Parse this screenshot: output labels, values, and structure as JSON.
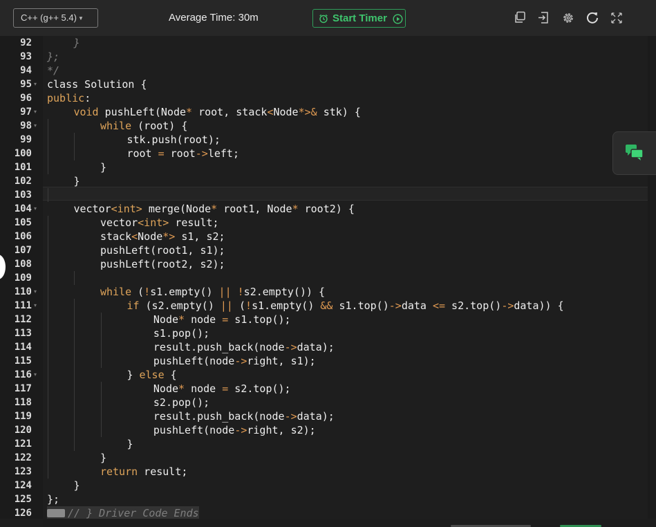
{
  "toolbar": {
    "language": "C++ (g++ 5.4)",
    "average_time": "Average Time: 30m",
    "timer_button": "Start Timer"
  },
  "colors": {
    "accent_green": "#3ec46d",
    "keyword": "#dfa45a",
    "comment": "#7e7e7e",
    "background": "#1e1e1e"
  },
  "icons": [
    "copy-icon",
    "sign-in-icon",
    "settings-gear-icon",
    "reset-icon",
    "fullscreen-icon",
    "chat-bubbles-icon",
    "alarm-clock-icon",
    "play-circle-icon"
  ],
  "editor": {
    "active_line": 103,
    "lines": [
      {
        "n": "92",
        "fold": false,
        "indent": 1,
        "tokens": [
          {
            "t": "}",
            "c": "c"
          }
        ]
      },
      {
        "n": "93",
        "fold": false,
        "indent": 0,
        "tokens": [
          {
            "t": "};",
            "c": "c"
          }
        ]
      },
      {
        "n": "94",
        "fold": false,
        "indent": 0,
        "tokens": [
          {
            "t": "*/",
            "c": "c"
          }
        ]
      },
      {
        "n": "95",
        "fold": true,
        "indent": 0,
        "tokens": [
          {
            "t": "class Solution {",
            "c": ""
          }
        ]
      },
      {
        "n": "96",
        "fold": false,
        "indent": 0,
        "tokens": [
          {
            "t": "public",
            "c": "k"
          },
          {
            "t": ":",
            "c": ""
          }
        ]
      },
      {
        "n": "97",
        "fold": true,
        "indent": 1,
        "tokens": [
          {
            "t": "void",
            "c": "k"
          },
          {
            "t": " pushLeft(Node",
            "c": ""
          },
          {
            "t": "*",
            "c": "o"
          },
          {
            "t": " root, stack",
            "c": ""
          },
          {
            "t": "<",
            "c": "o"
          },
          {
            "t": "Node",
            "c": ""
          },
          {
            "t": "*>&",
            "c": "o"
          },
          {
            "t": " stk) {",
            "c": ""
          }
        ]
      },
      {
        "n": "98",
        "fold": true,
        "indent": 2,
        "tokens": [
          {
            "t": "while",
            "c": "k"
          },
          {
            "t": " (root) {",
            "c": ""
          }
        ]
      },
      {
        "n": "99",
        "fold": false,
        "indent": 3,
        "tokens": [
          {
            "t": "stk.push(root);",
            "c": ""
          }
        ]
      },
      {
        "n": "100",
        "fold": false,
        "indent": 3,
        "tokens": [
          {
            "t": "root ",
            "c": ""
          },
          {
            "t": "=",
            "c": "o"
          },
          {
            "t": " root",
            "c": ""
          },
          {
            "t": "->",
            "c": "o"
          },
          {
            "t": "left;",
            "c": ""
          }
        ]
      },
      {
        "n": "101",
        "fold": false,
        "indent": 2,
        "tokens": [
          {
            "t": "}",
            "c": ""
          }
        ]
      },
      {
        "n": "102",
        "fold": false,
        "indent": 1,
        "tokens": [
          {
            "t": "}",
            "c": ""
          }
        ]
      },
      {
        "n": "103",
        "fold": false,
        "indent": 1,
        "tokens": []
      },
      {
        "n": "104",
        "fold": true,
        "indent": 1,
        "tokens": [
          {
            "t": "vector",
            "c": ""
          },
          {
            "t": "<int>",
            "c": "k"
          },
          {
            "t": " merge(Node",
            "c": ""
          },
          {
            "t": "*",
            "c": "o"
          },
          {
            "t": " root1, Node",
            "c": ""
          },
          {
            "t": "*",
            "c": "o"
          },
          {
            "t": " root2) {",
            "c": ""
          }
        ]
      },
      {
        "n": "105",
        "fold": false,
        "indent": 2,
        "tokens": [
          {
            "t": "vector",
            "c": ""
          },
          {
            "t": "<int>",
            "c": "k"
          },
          {
            "t": " result;",
            "c": ""
          }
        ]
      },
      {
        "n": "106",
        "fold": false,
        "indent": 2,
        "tokens": [
          {
            "t": "stack",
            "c": ""
          },
          {
            "t": "<",
            "c": "o"
          },
          {
            "t": "Node",
            "c": ""
          },
          {
            "t": "*>",
            "c": "o"
          },
          {
            "t": " s1, s2;",
            "c": ""
          }
        ]
      },
      {
        "n": "107",
        "fold": false,
        "indent": 2,
        "tokens": [
          {
            "t": "pushLeft(root1, s1);",
            "c": ""
          }
        ]
      },
      {
        "n": "108",
        "fold": false,
        "indent": 2,
        "tokens": [
          {
            "t": "pushLeft(root2, s2);",
            "c": ""
          }
        ]
      },
      {
        "n": "109",
        "fold": false,
        "indent": 2,
        "tokens": []
      },
      {
        "n": "110",
        "fold": true,
        "indent": 2,
        "tokens": [
          {
            "t": "while",
            "c": "k"
          },
          {
            "t": " (",
            "c": ""
          },
          {
            "t": "!",
            "c": "o"
          },
          {
            "t": "s1.empty() ",
            "c": ""
          },
          {
            "t": "||",
            "c": "o"
          },
          {
            "t": " ",
            "c": ""
          },
          {
            "t": "!",
            "c": "o"
          },
          {
            "t": "s2.empty()) {",
            "c": ""
          }
        ]
      },
      {
        "n": "111",
        "fold": true,
        "indent": 3,
        "tokens": [
          {
            "t": "if",
            "c": "k"
          },
          {
            "t": " (s2.empty() ",
            "c": ""
          },
          {
            "t": "||",
            "c": "o"
          },
          {
            "t": " (",
            "c": ""
          },
          {
            "t": "!",
            "c": "o"
          },
          {
            "t": "s1.empty() ",
            "c": ""
          },
          {
            "t": "&&",
            "c": "o"
          },
          {
            "t": " s1.top()",
            "c": ""
          },
          {
            "t": "->",
            "c": "o"
          },
          {
            "t": "data ",
            "c": ""
          },
          {
            "t": "<=",
            "c": "o"
          },
          {
            "t": " s2.top()",
            "c": ""
          },
          {
            "t": "->",
            "c": "o"
          },
          {
            "t": "data)) {",
            "c": ""
          }
        ]
      },
      {
        "n": "112",
        "fold": false,
        "indent": 4,
        "tokens": [
          {
            "t": "Node",
            "c": ""
          },
          {
            "t": "*",
            "c": "o"
          },
          {
            "t": " node ",
            "c": ""
          },
          {
            "t": "=",
            "c": "o"
          },
          {
            "t": " s1.top();",
            "c": ""
          }
        ]
      },
      {
        "n": "113",
        "fold": false,
        "indent": 4,
        "tokens": [
          {
            "t": "s1.pop();",
            "c": ""
          }
        ]
      },
      {
        "n": "114",
        "fold": false,
        "indent": 4,
        "tokens": [
          {
            "t": "result.push_back(node",
            "c": ""
          },
          {
            "t": "->",
            "c": "o"
          },
          {
            "t": "data);",
            "c": ""
          }
        ]
      },
      {
        "n": "115",
        "fold": false,
        "indent": 4,
        "tokens": [
          {
            "t": "pushLeft(node",
            "c": ""
          },
          {
            "t": "->",
            "c": "o"
          },
          {
            "t": "right, s1);",
            "c": ""
          }
        ]
      },
      {
        "n": "116",
        "fold": true,
        "indent": 3,
        "tokens": [
          {
            "t": "} ",
            "c": ""
          },
          {
            "t": "else",
            "c": "k"
          },
          {
            "t": " {",
            "c": ""
          }
        ]
      },
      {
        "n": "117",
        "fold": false,
        "indent": 4,
        "tokens": [
          {
            "t": "Node",
            "c": ""
          },
          {
            "t": "*",
            "c": "o"
          },
          {
            "t": " node ",
            "c": ""
          },
          {
            "t": "=",
            "c": "o"
          },
          {
            "t": " s2.top();",
            "c": ""
          }
        ]
      },
      {
        "n": "118",
        "fold": false,
        "indent": 4,
        "tokens": [
          {
            "t": "s2.pop();",
            "c": ""
          }
        ]
      },
      {
        "n": "119",
        "fold": false,
        "indent": 4,
        "tokens": [
          {
            "t": "result.push_back(node",
            "c": ""
          },
          {
            "t": "->",
            "c": "o"
          },
          {
            "t": "data);",
            "c": ""
          }
        ]
      },
      {
        "n": "120",
        "fold": false,
        "indent": 4,
        "tokens": [
          {
            "t": "pushLeft(node",
            "c": ""
          },
          {
            "t": "->",
            "c": "o"
          },
          {
            "t": "right, s2);",
            "c": ""
          }
        ]
      },
      {
        "n": "121",
        "fold": false,
        "indent": 3,
        "tokens": [
          {
            "t": "}",
            "c": ""
          }
        ]
      },
      {
        "n": "122",
        "fold": false,
        "indent": 2,
        "tokens": [
          {
            "t": "}",
            "c": ""
          }
        ]
      },
      {
        "n": "123",
        "fold": false,
        "indent": 2,
        "tokens": [
          {
            "t": "return",
            "c": "k"
          },
          {
            "t": " result;",
            "c": ""
          }
        ]
      },
      {
        "n": "124",
        "fold": false,
        "indent": 1,
        "tokens": [
          {
            "t": "}",
            "c": ""
          }
        ]
      },
      {
        "n": "125",
        "fold": false,
        "indent": 0,
        "tokens": [
          {
            "t": "};",
            "c": ""
          }
        ]
      },
      {
        "n": "126",
        "fold": false,
        "indent": 0,
        "folded": true,
        "tokens": [
          {
            "t": "// } Driver Code Ends",
            "c": "c"
          }
        ]
      }
    ]
  }
}
